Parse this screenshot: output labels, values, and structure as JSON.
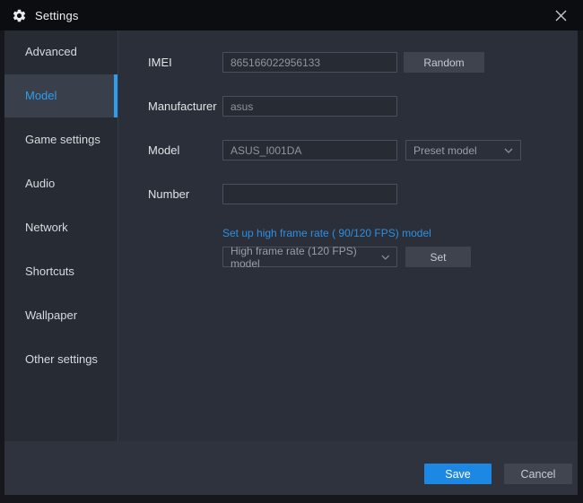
{
  "window": {
    "title": "Settings"
  },
  "icons": {
    "titlebar_gear": "gear",
    "close": "x-cross",
    "dropdown_chevron": "chevron-down"
  },
  "colors": {
    "titlebar_bg": "#0b0d11",
    "body_bg": "#2b2f39",
    "sidebar_bg": "#272b33",
    "selected_item_bg": "#3a404b",
    "accent_blue": "#2f9ded",
    "save_blue": "#1d87e4",
    "link_blue": "#2e8fdf"
  },
  "sidebar": {
    "items": [
      {
        "label": "Advanced",
        "selected": false
      },
      {
        "label": "Model",
        "selected": true
      },
      {
        "label": "Game settings",
        "selected": false
      },
      {
        "label": "Audio",
        "selected": false
      },
      {
        "label": "Network",
        "selected": false
      },
      {
        "label": "Shortcuts",
        "selected": false
      },
      {
        "label": "Wallpaper",
        "selected": false
      },
      {
        "label": "Other settings",
        "selected": false
      }
    ]
  },
  "form": {
    "imei": {
      "label": "IMEI",
      "value": "865166022956133",
      "random_button": "Random"
    },
    "manufacturer": {
      "label": "Manufacturer",
      "value": "asus"
    },
    "model": {
      "label": "Model",
      "value": "ASUS_I001DA",
      "preset_dropdown": "Preset model"
    },
    "number": {
      "label": "Number",
      "value": ""
    },
    "high_frame_rate": {
      "link": "Set up high frame rate ( 90/120 FPS) model",
      "dropdown": "High frame rate (120 FPS) model",
      "set_button": "Set"
    }
  },
  "footer": {
    "save_button": "Save",
    "cancel_button": "Cancel"
  }
}
